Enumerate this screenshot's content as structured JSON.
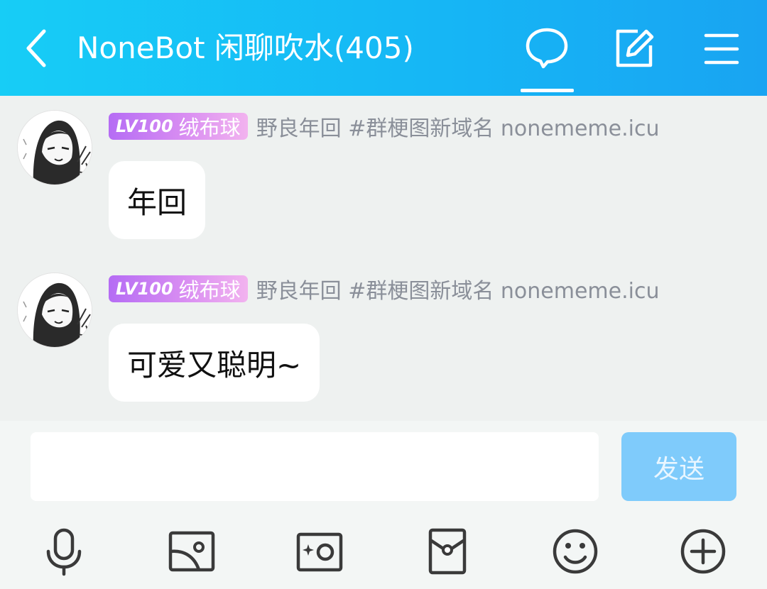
{
  "header": {
    "title": "NoneBot 闲聊吹水(405)",
    "icons": [
      "back-icon",
      "chat-bubble-icon",
      "edit-icon",
      "menu-icon"
    ],
    "active_tab_indicator": "chat"
  },
  "messages": [
    {
      "level": "LV100",
      "title_badge": "绒布球",
      "nickname": "野良年回 #群梗图新域名 nonememe.icu",
      "text": "年回"
    },
    {
      "level": "LV100",
      "title_badge": "绒布球",
      "nickname": "野良年回 #群梗图新域名 nonememe.icu",
      "text": "可爱又聪明~"
    }
  ],
  "input": {
    "value": "",
    "send_label": "发送"
  },
  "toolbar": {
    "icons": [
      "microphone-icon",
      "image-icon",
      "camera-icon",
      "red-packet-icon",
      "emoji-icon",
      "plus-icon"
    ]
  },
  "colors": {
    "header_gradient_start": "#17cdf6",
    "header_gradient_end": "#19a4f2",
    "badge_gradient_start": "#b56cf4",
    "badge_gradient_end": "#f2b3ef",
    "send_button": "#7fcbfb",
    "chat_background": "#eef1f0"
  }
}
